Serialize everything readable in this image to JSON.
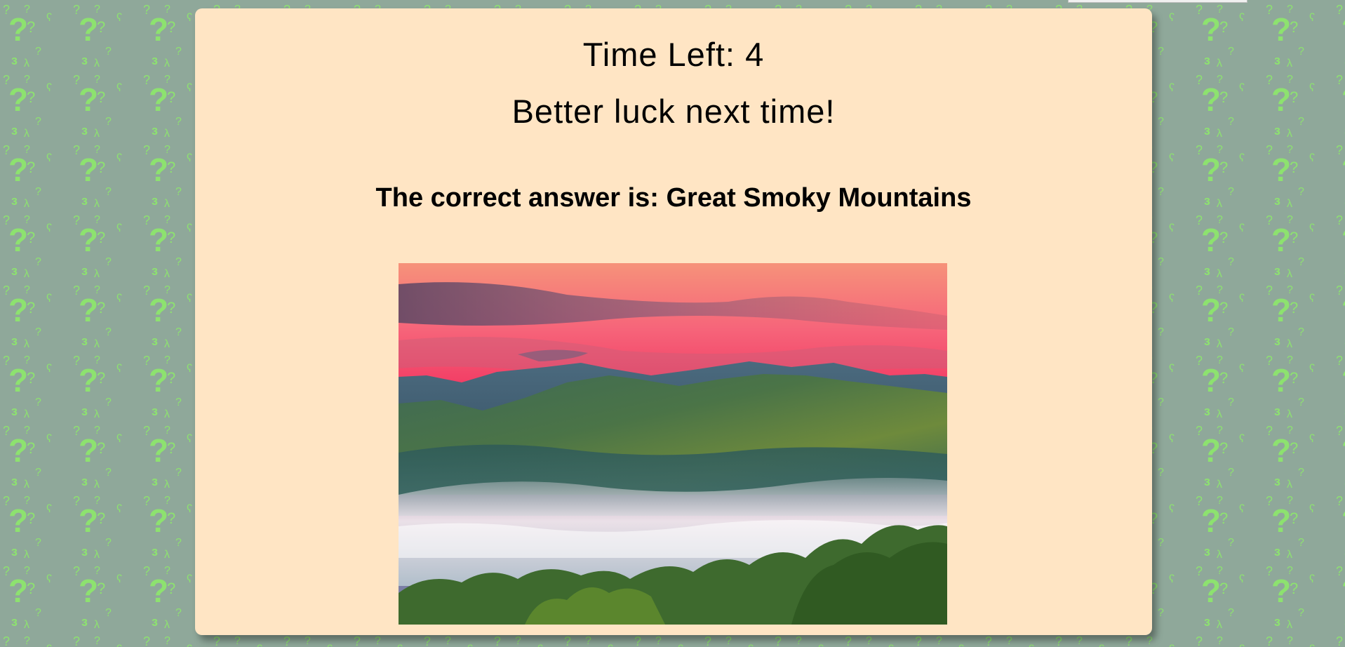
{
  "game": {
    "timer_label": "Time Left:",
    "time_left": "4",
    "feedback": "Better luck next time!",
    "answer_prefix": "The correct answer is:",
    "answer": "Great Smoky Mountains"
  },
  "image": {
    "subject": "mountain landscape at sunset with fog in the valley"
  },
  "colors": {
    "background": "#8fa89a",
    "pattern_glyph": "#8de26f",
    "card_background": "#ffe5c4",
    "text": "#000000"
  },
  "icons": {
    "background_pattern": "question-mark-pattern"
  }
}
